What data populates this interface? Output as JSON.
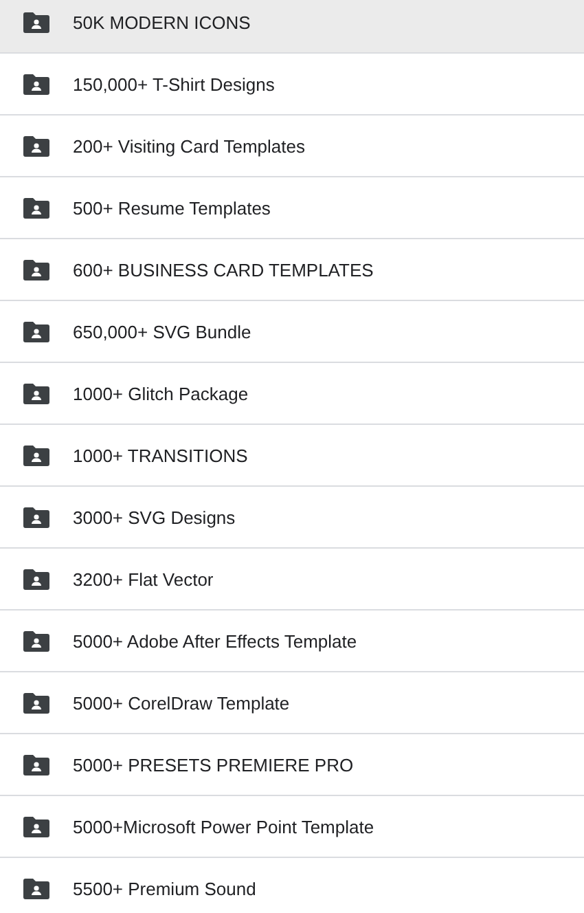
{
  "folders": [
    {
      "name": "50K MODERN ICONS",
      "selected": true
    },
    {
      "name": "150,000+ T-Shirt Designs",
      "selected": false
    },
    {
      "name": "200+ Visiting Card Templates",
      "selected": false
    },
    {
      "name": "500+ Resume Templates",
      "selected": false
    },
    {
      "name": "600+ BUSINESS CARD TEMPLATES",
      "selected": false
    },
    {
      "name": "650,000+ SVG Bundle",
      "selected": false
    },
    {
      "name": "1000+ Glitch Package",
      "selected": false
    },
    {
      "name": "1000+ TRANSITIONS",
      "selected": false
    },
    {
      "name": "3000+ SVG Designs",
      "selected": false
    },
    {
      "name": "3200+ Flat Vector",
      "selected": false
    },
    {
      "name": "5000+ Adobe After Effects Template",
      "selected": false
    },
    {
      "name": "5000+ CorelDraw Template",
      "selected": false
    },
    {
      "name": "5000+ PRESETS PREMIERE PRO",
      "selected": false
    },
    {
      "name": "5000+Microsoft Power Point Template",
      "selected": false
    },
    {
      "name": "5500+ Premium Sound",
      "selected": false
    }
  ]
}
